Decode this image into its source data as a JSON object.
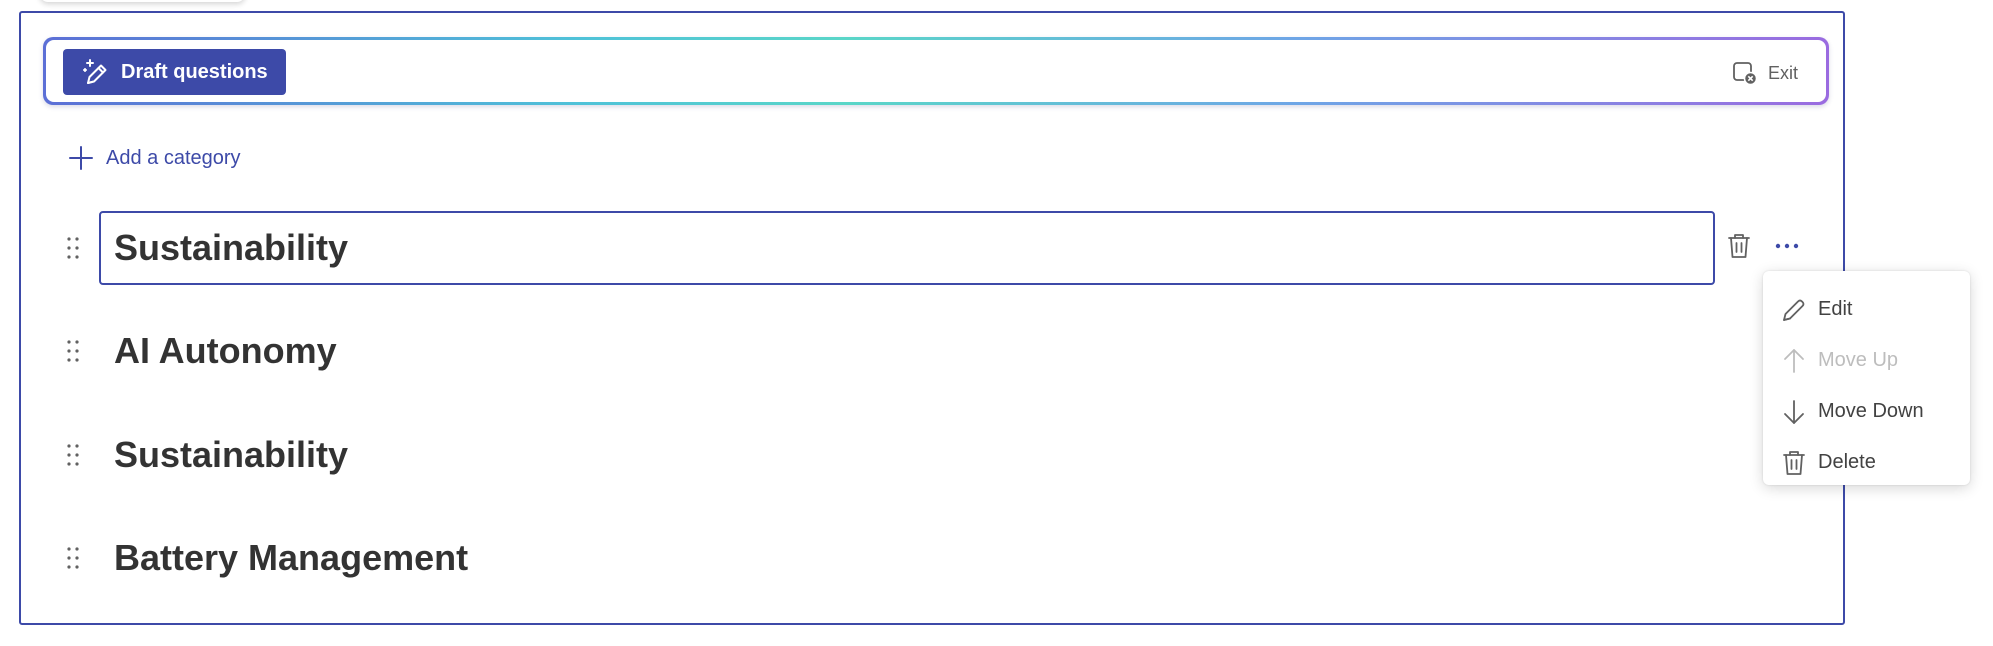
{
  "toolbar": {
    "draft_label": "Draft questions",
    "exit_label": "Exit"
  },
  "add_category_label": "Add a category",
  "categories": [
    {
      "title": "Sustainability",
      "editing": true
    },
    {
      "title": "AI Autonomy"
    },
    {
      "title": "Sustainability"
    },
    {
      "title": "Battery Management"
    }
  ],
  "context_menu": {
    "items": [
      {
        "label": "Edit",
        "icon": "pencil-icon",
        "disabled": false
      },
      {
        "label": "Move Up",
        "icon": "arrow-up-icon",
        "disabled": true
      },
      {
        "label": "Move Down",
        "icon": "arrow-down-icon",
        "disabled": false
      },
      {
        "label": "Delete",
        "icon": "trash-icon",
        "disabled": false
      }
    ]
  },
  "colors": {
    "accent": "#3d4aa8",
    "text": "#333333",
    "muted": "#616161",
    "disabled": "#bdbdbd"
  }
}
